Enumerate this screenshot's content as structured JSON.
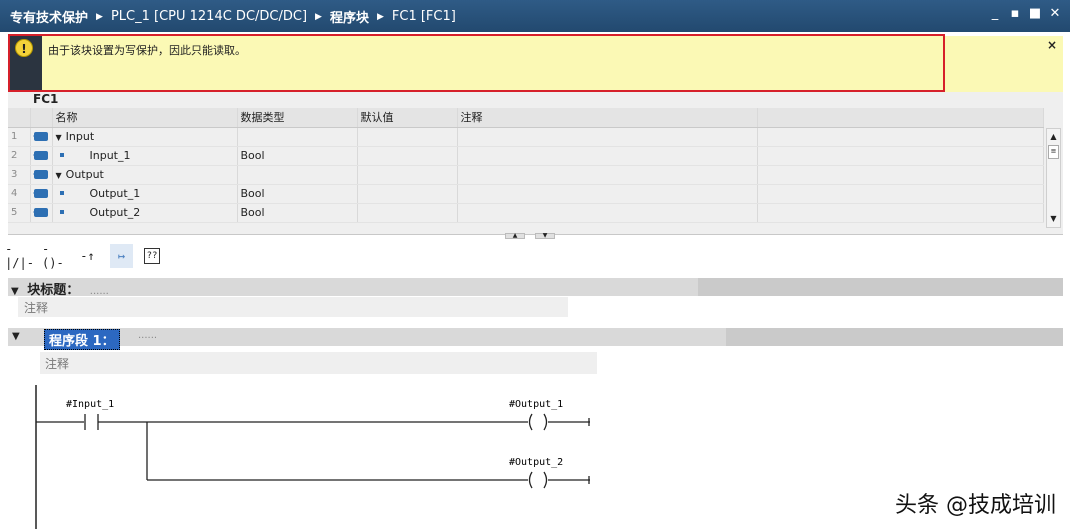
{
  "breadcrumb": [
    "专有技术保护",
    "PLC_1 [CPU 1214C DC/DC/DC]",
    "程序块",
    "FC1 [FC1]"
  ],
  "window_controls": [
    "_",
    "▪",
    "■",
    "✕"
  ],
  "banner": {
    "text": "由于该块设置为写保护，因此只能读取。",
    "icon": "warning-icon",
    "close": "×",
    "icon_glyph": "!"
  },
  "block_name": "FC1",
  "interface": {
    "columns": [
      "名称",
      "数据类型",
      "默认值",
      "注释"
    ],
    "rows": [
      {
        "n": "1",
        "name": "Input",
        "type": ""
      },
      {
        "n": "2",
        "name": "Input_1",
        "type": "Bool"
      },
      {
        "n": "3",
        "name": "Output",
        "type": ""
      },
      {
        "n": "4",
        "name": "Output_1",
        "type": "Bool"
      },
      {
        "n": "5",
        "name": "Output_2",
        "type": "Bool"
      }
    ]
  },
  "toolbar": [
    "-|/|-",
    "-()-",
    "-↑",
    "↦",
    "??"
  ],
  "block_title": {
    "label": "块标题：",
    "dots": "......",
    "comment": "注释"
  },
  "network": {
    "label": "程序段 1：",
    "dots": "......",
    "comment": "注释"
  },
  "ladder": {
    "contact": "#Input_1",
    "coil1": "#Output_1",
    "coil2": "#Output_2"
  },
  "watermark": "头条 @技成培训"
}
